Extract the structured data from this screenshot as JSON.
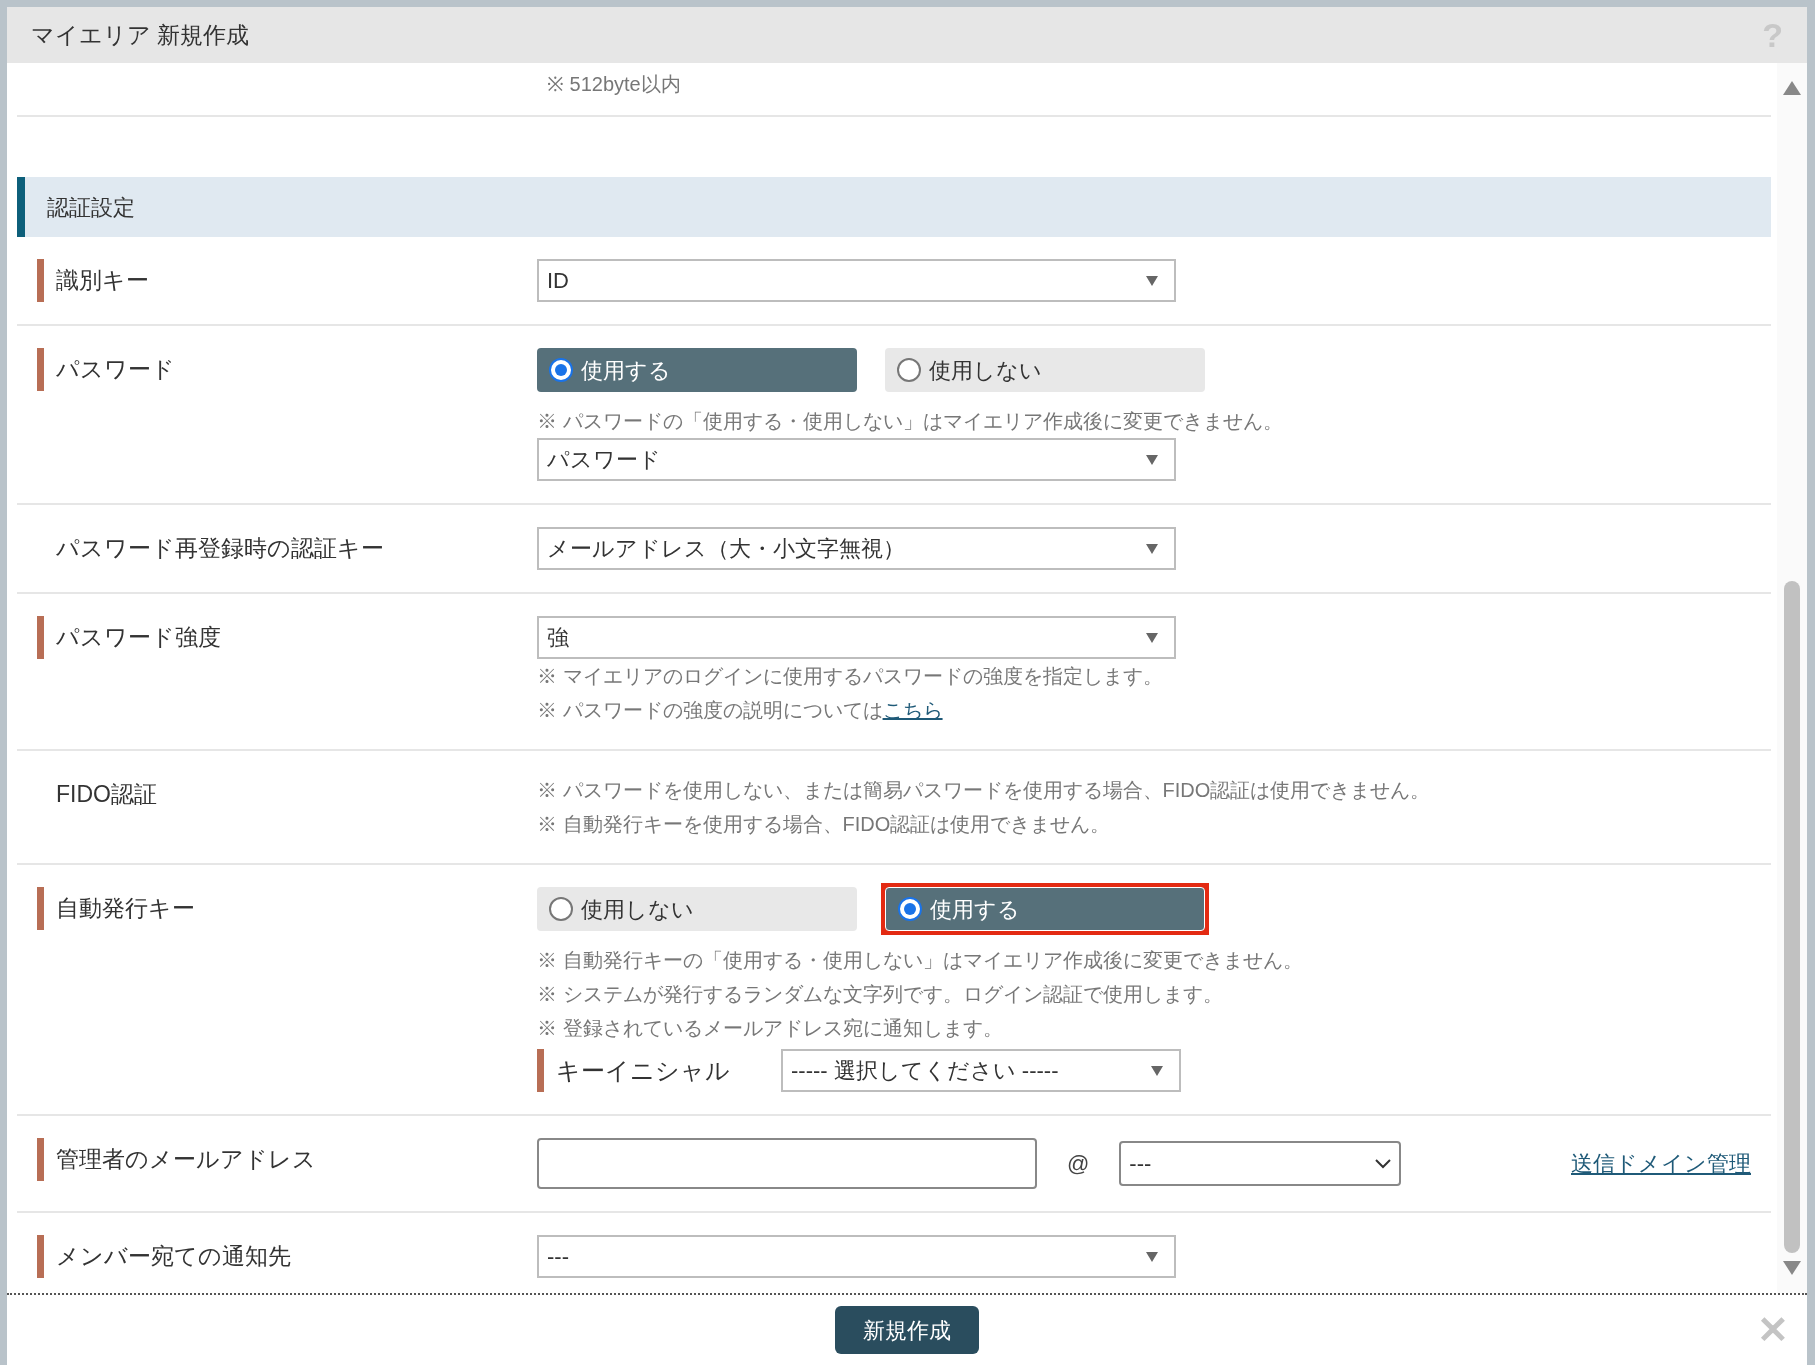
{
  "dialog": {
    "title": "マイエリア 新規作成",
    "help": "?"
  },
  "top_note": "※ 512byte以内",
  "section": {
    "title": "認証設定"
  },
  "rows": [
    {
      "label": "識別キー",
      "required": true,
      "items": [
        {
          "kind": "select",
          "value": "ID"
        }
      ]
    },
    {
      "label": "パスワード",
      "required": true,
      "items": [
        {
          "kind": "radios",
          "options": [
            {
              "label": "使用する",
              "selected": true,
              "highlighted": false
            },
            {
              "label": "使用しない",
              "selected": false,
              "highlighted": false
            }
          ]
        },
        {
          "kind": "note",
          "text": "※ パスワードの「使用する・使用しない」はマイエリア作成後に変更できません。"
        },
        {
          "kind": "select",
          "value": "パスワード"
        }
      ]
    },
    {
      "label": "パスワード再登録時の認証キー",
      "required": false,
      "items": [
        {
          "kind": "select",
          "value": "メールアドレス（大・小文字無視）"
        }
      ]
    },
    {
      "label": "パスワード強度",
      "required": true,
      "items": [
        {
          "kind": "select",
          "value": "強"
        },
        {
          "kind": "note",
          "text": "※ マイエリアのログインに使用するパスワードの強度を指定します。"
        },
        {
          "kind": "note",
          "text": "※ パスワードの強度の説明については",
          "link": "こちら"
        }
      ]
    },
    {
      "label": "FIDO認証",
      "required": false,
      "items": [
        {
          "kind": "note",
          "text": "※ パスワードを使用しない、または簡易パスワードを使用する場合、FIDO認証は使用できません。"
        },
        {
          "kind": "note",
          "text": "※ 自動発行キーを使用する場合、FIDO認証は使用できません。"
        }
      ]
    },
    {
      "label": "自動発行キー",
      "required": true,
      "items": [
        {
          "kind": "radios",
          "options": [
            {
              "label": "使用しない",
              "selected": false,
              "highlighted": false
            },
            {
              "label": "使用する",
              "selected": true,
              "highlighted": true
            }
          ]
        },
        {
          "kind": "note",
          "text": "※ 自動発行キーの「使用する・使用しない」はマイエリア作成後に変更できません。"
        },
        {
          "kind": "note",
          "text": "※ システムが発行するランダムな文字列です。ログイン認証で使用します。"
        },
        {
          "kind": "note",
          "text": "※ 登録されているメールアドレス宛に通知します。"
        },
        {
          "kind": "subselect",
          "label": "キーイニシャル",
          "required": true,
          "value": "----- 選択してください -----"
        }
      ]
    },
    {
      "label": "管理者のメールアドレス",
      "required": true,
      "items": [
        {
          "kind": "email",
          "at": "@",
          "domain": "---",
          "link": "送信ドメイン管理"
        }
      ]
    },
    {
      "label": "メンバー宛ての通知先",
      "required": true,
      "items": [
        {
          "kind": "select",
          "value": "---"
        }
      ]
    }
  ],
  "footer": {
    "button": "新規作成",
    "close": "✕"
  }
}
